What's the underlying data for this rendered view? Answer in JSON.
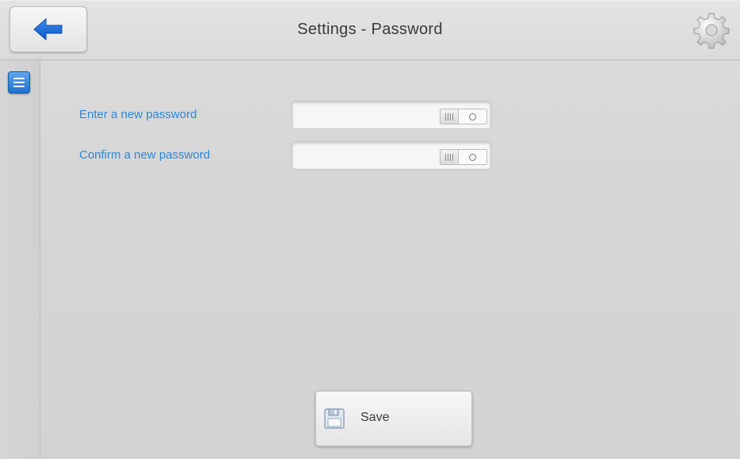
{
  "header": {
    "title": "Settings - Password",
    "back_icon": "arrow-left-icon",
    "settings_icon": "gear-icon"
  },
  "sidebar": {
    "menu_icon": "menu-icon"
  },
  "form": {
    "new_password": {
      "label": "Enter a new password",
      "value": "",
      "toggle_icon": "show-password-toggle"
    },
    "confirm_password": {
      "label": "Confirm a new password",
      "value": "",
      "toggle_icon": "show-password-toggle"
    }
  },
  "footer": {
    "save_label": "Save",
    "save_icon": "floppy-disk-icon"
  },
  "colors": {
    "label_blue": "#2f86d6",
    "accent_blue": "#1f6fcf"
  }
}
